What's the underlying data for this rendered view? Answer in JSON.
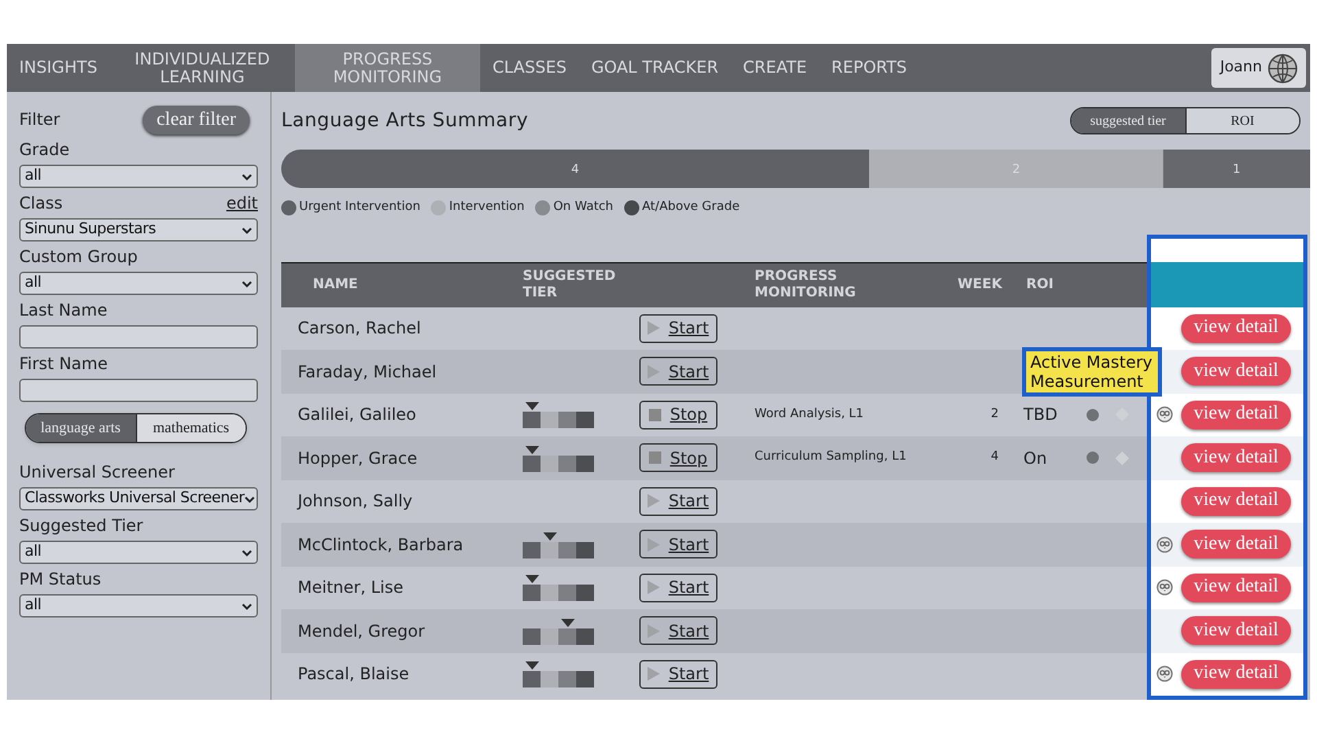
{
  "nav": {
    "items": [
      {
        "label": "INSIGHTS",
        "selected": false
      },
      {
        "label": "INDIVIDUALIZED LEARNING",
        "selected": false
      },
      {
        "label": "PROGRESS MONITORING",
        "selected": true
      },
      {
        "label": "CLASSES",
        "selected": false
      },
      {
        "label": "GOAL TRACKER",
        "selected": false
      },
      {
        "label": "CREATE",
        "selected": false
      },
      {
        "label": "REPORTS",
        "selected": false
      }
    ],
    "user": "Joann"
  },
  "sidebar": {
    "title": "Filter",
    "clear": "clear filter",
    "fields": [
      {
        "kind": "select",
        "label": "Grade",
        "value": "all"
      },
      {
        "kind": "select",
        "label": "Class",
        "link": "edit",
        "value": "Sinunu Superstars"
      },
      {
        "kind": "select",
        "label": "Custom Group",
        "value": "all"
      },
      {
        "kind": "input",
        "label": "Last Name"
      },
      {
        "kind": "input",
        "label": "First Name"
      },
      {
        "kind": "toggle",
        "options": [
          {
            "label": "language arts",
            "selected": true
          },
          {
            "label": "mathematics",
            "selected": false
          }
        ]
      },
      {
        "kind": "select",
        "label": "Universal Screener",
        "value": "Classworks Universal Screener"
      },
      {
        "kind": "select",
        "label": "Suggested Tier",
        "value": "all"
      },
      {
        "kind": "select",
        "label": "PM Status",
        "value": "all"
      }
    ]
  },
  "summary": {
    "title": "Language Arts Summary",
    "view_toggle": [
      {
        "label": "suggested tier",
        "selected": true
      },
      {
        "label": "ROI",
        "selected": false
      }
    ],
    "chart_data": {
      "type": "bar",
      "orientation": "horizontal",
      "stacked": true,
      "data_labels": true,
      "series": [
        {
          "color": "#5f6166",
          "values": [
            4
          ]
        },
        {
          "color": "#aeb0b6",
          "values": [
            2
          ]
        },
        {
          "color": "#66686d",
          "values": [
            1
          ]
        }
      ]
    },
    "legend": [
      {
        "label": "Urgent Intervention",
        "color": "#5f6166"
      },
      {
        "label": "Intervention",
        "color": "#aeb0b6"
      },
      {
        "label": "On Watch",
        "color": "#898b90"
      },
      {
        "label": "At/Above Grade",
        "color": "#48494d"
      }
    ]
  },
  "table": {
    "columns": [
      "NAME",
      "SUGGESTED TIER",
      "PROGRESS MONITORING",
      "WEEK",
      "ROI"
    ],
    "rows": [
      {
        "name": "Carson, Rachel",
        "button": {
          "kind": "start",
          "label": "Start"
        },
        "badge": false,
        "detail": "view detail"
      },
      {
        "name": "Faraday, Michael",
        "button": {
          "kind": "start",
          "label": "Start"
        },
        "badge": false,
        "detail": "view detail"
      },
      {
        "name": "Galilei, Galileo",
        "tier": [
          {
            "selected": true
          },
          {
            "selected": false
          },
          {
            "selected": false
          },
          {
            "selected": false
          }
        ],
        "button": {
          "kind": "stop",
          "label": "Stop"
        },
        "monitoring": "Word Analysis, L1",
        "week": "2",
        "roi": "TBD",
        "status": true,
        "badge": true,
        "detail": "view detail"
      },
      {
        "name": "Hopper, Grace",
        "tier": [
          {
            "selected": true
          },
          {
            "selected": false
          },
          {
            "selected": false
          },
          {
            "selected": false
          }
        ],
        "button": {
          "kind": "stop",
          "label": "Stop"
        },
        "monitoring": "Curriculum Sampling, L1",
        "week": "4",
        "roi": "On",
        "status": true,
        "badge": false,
        "detail": "view detail"
      },
      {
        "name": "Johnson, Sally",
        "button": {
          "kind": "start",
          "label": "Start"
        },
        "badge": false,
        "detail": "view detail"
      },
      {
        "name": "McClintock, Barbara",
        "tier": [
          {
            "selected": false
          },
          {
            "selected": true
          },
          {
            "selected": false
          },
          {
            "selected": false
          }
        ],
        "button": {
          "kind": "start",
          "label": "Start"
        },
        "badge": true,
        "detail": "view detail"
      },
      {
        "name": "Meitner, Lise",
        "tier": [
          {
            "selected": true
          },
          {
            "selected": false
          },
          {
            "selected": false
          },
          {
            "selected": false
          }
        ],
        "button": {
          "kind": "start",
          "label": "Start"
        },
        "badge": true,
        "detail": "view detail"
      },
      {
        "name": "Mendel, Gregor",
        "tier": [
          {
            "selected": false
          },
          {
            "selected": false
          },
          {
            "selected": true
          },
          {
            "selected": false
          }
        ],
        "button": {
          "kind": "start",
          "label": "Start"
        },
        "badge": false,
        "detail": "view detail"
      },
      {
        "name": "Pascal, Blaise",
        "tier": [
          {
            "selected": true
          },
          {
            "selected": false
          },
          {
            "selected": false
          },
          {
            "selected": false
          }
        ],
        "button": {
          "kind": "start",
          "label": "Start"
        },
        "badge": true,
        "detail": "view detail"
      }
    ]
  },
  "tooltip": "Active Mastery Measurement"
}
